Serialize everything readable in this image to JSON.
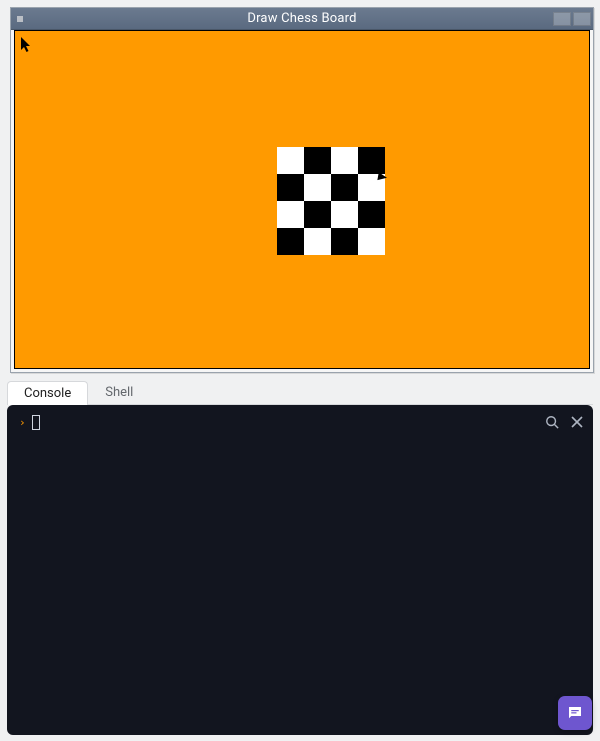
{
  "window": {
    "title": "Draw Chess Board"
  },
  "canvas": {
    "background_color": "#ff9a00",
    "chessboard": {
      "rows": 4,
      "cols": 4,
      "colors": {
        "light": "#ffffff",
        "dark": "#000000"
      },
      "pattern": [
        [
          "w",
          "b",
          "w",
          "b"
        ],
        [
          "b",
          "w",
          "b",
          "w"
        ],
        [
          "w",
          "b",
          "w",
          "b"
        ],
        [
          "b",
          "w",
          "b",
          "w"
        ]
      ],
      "turtle_visible": true
    }
  },
  "tabs": [
    {
      "id": "console",
      "label": "Console",
      "active": true
    },
    {
      "id": "shell",
      "label": "Shell",
      "active": false
    }
  ],
  "console": {
    "prompt_symbol": "›",
    "input_value": "",
    "tools": {
      "search_icon": "search-icon",
      "close_icon": "close-icon"
    }
  },
  "chat_button": {
    "icon": "chat-icon"
  },
  "colors": {
    "accent": "#ff9a00",
    "titlebar": "#5f6e85",
    "console_bg": "#12151f",
    "fab": "#6e56cf"
  }
}
